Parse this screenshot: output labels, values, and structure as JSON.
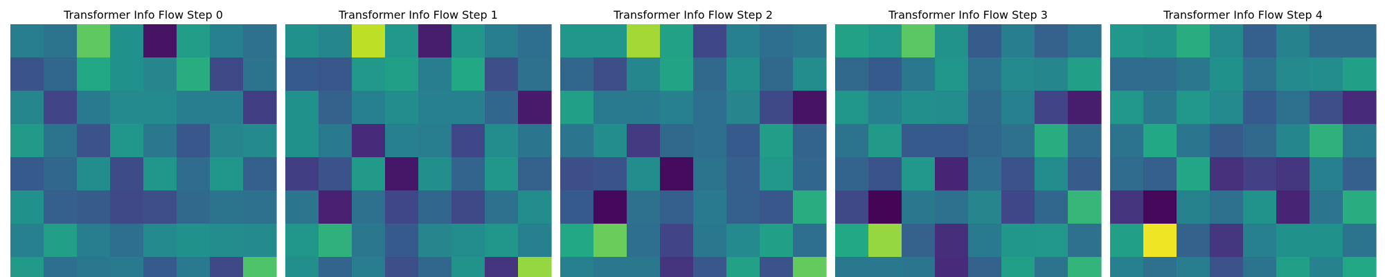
{
  "figure": {
    "background": "#ffffff"
  },
  "chart_data": [
    {
      "type": "heatmap",
      "title": "Transformer Info Flow Step 0",
      "colormap": "viridis",
      "axes": "off",
      "grid": false,
      "values": [
        [
          0.42,
          0.38,
          0.75,
          0.5,
          0.05,
          0.55,
          0.43,
          0.37
        ],
        [
          0.26,
          0.33,
          0.6,
          0.5,
          0.45,
          0.62,
          0.22,
          0.38
        ],
        [
          0.46,
          0.2,
          0.41,
          0.47,
          0.47,
          0.42,
          0.42,
          0.18
        ],
        [
          0.54,
          0.38,
          0.25,
          0.52,
          0.4,
          0.27,
          0.45,
          0.47
        ],
        [
          0.28,
          0.33,
          0.48,
          0.23,
          0.52,
          0.35,
          0.52,
          0.3
        ],
        [
          0.5,
          0.3,
          0.29,
          0.22,
          0.24,
          0.34,
          0.38,
          0.37
        ],
        [
          0.43,
          0.56,
          0.42,
          0.36,
          0.47,
          0.5,
          0.48,
          0.47
        ],
        [
          0.54,
          0.36,
          0.4,
          0.41,
          0.28,
          0.41,
          0.22,
          0.72
        ]
      ]
    },
    {
      "type": "heatmap",
      "title": "Transformer Info Flow Step 1",
      "colormap": "viridis",
      "axes": "off",
      "grid": false,
      "values": [
        [
          0.5,
          0.46,
          0.9,
          0.53,
          0.08,
          0.52,
          0.42,
          0.36
        ],
        [
          0.28,
          0.27,
          0.53,
          0.56,
          0.42,
          0.6,
          0.24,
          0.37
        ],
        [
          0.5,
          0.31,
          0.43,
          0.48,
          0.43,
          0.43,
          0.33,
          0.07
        ],
        [
          0.5,
          0.41,
          0.12,
          0.43,
          0.42,
          0.21,
          0.48,
          0.39
        ],
        [
          0.18,
          0.25,
          0.54,
          0.06,
          0.49,
          0.32,
          0.52,
          0.31
        ],
        [
          0.39,
          0.09,
          0.37,
          0.21,
          0.33,
          0.22,
          0.37,
          0.48
        ],
        [
          0.52,
          0.64,
          0.4,
          0.28,
          0.45,
          0.48,
          0.52,
          0.43
        ],
        [
          0.49,
          0.32,
          0.42,
          0.24,
          0.33,
          0.51,
          0.15,
          0.84
        ]
      ]
    },
    {
      "type": "heatmap",
      "title": "Transformer Info Flow Step 2",
      "colormap": "viridis",
      "axes": "off",
      "grid": false,
      "values": [
        [
          0.52,
          0.52,
          0.86,
          0.57,
          0.21,
          0.43,
          0.36,
          0.4
        ],
        [
          0.33,
          0.24,
          0.46,
          0.58,
          0.34,
          0.49,
          0.34,
          0.48
        ],
        [
          0.56,
          0.41,
          0.41,
          0.43,
          0.36,
          0.45,
          0.22,
          0.05
        ],
        [
          0.39,
          0.48,
          0.17,
          0.34,
          0.36,
          0.28,
          0.55,
          0.32
        ],
        [
          0.24,
          0.26,
          0.48,
          0.03,
          0.38,
          0.3,
          0.53,
          0.33
        ],
        [
          0.28,
          0.02,
          0.37,
          0.3,
          0.41,
          0.3,
          0.27,
          0.62
        ],
        [
          0.6,
          0.77,
          0.36,
          0.2,
          0.4,
          0.47,
          0.56,
          0.36
        ],
        [
          0.43,
          0.4,
          0.4,
          0.15,
          0.27,
          0.57,
          0.25,
          0.76
        ]
      ]
    },
    {
      "type": "heatmap",
      "title": "Transformer Info Flow Step 3",
      "colormap": "viridis",
      "axes": "off",
      "grid": false,
      "values": [
        [
          0.57,
          0.53,
          0.74,
          0.51,
          0.29,
          0.42,
          0.31,
          0.39
        ],
        [
          0.34,
          0.28,
          0.4,
          0.52,
          0.37,
          0.47,
          0.46,
          0.56
        ],
        [
          0.52,
          0.43,
          0.49,
          0.48,
          0.34,
          0.43,
          0.2,
          0.08
        ],
        [
          0.38,
          0.54,
          0.28,
          0.28,
          0.33,
          0.37,
          0.62,
          0.35
        ],
        [
          0.32,
          0.26,
          0.53,
          0.1,
          0.36,
          0.25,
          0.48,
          0.29
        ],
        [
          0.22,
          0.01,
          0.4,
          0.37,
          0.45,
          0.21,
          0.33,
          0.66
        ],
        [
          0.6,
          0.84,
          0.31,
          0.13,
          0.41,
          0.52,
          0.53,
          0.37
        ],
        [
          0.4,
          0.4,
          0.39,
          0.12,
          0.31,
          0.56,
          0.38,
          0.65
        ]
      ]
    },
    {
      "type": "heatmap",
      "title": "Transformer Info Flow Step 4",
      "colormap": "viridis",
      "axes": "off",
      "grid": false,
      "values": [
        [
          0.53,
          0.51,
          0.62,
          0.47,
          0.3,
          0.44,
          0.34,
          0.34
        ],
        [
          0.35,
          0.35,
          0.4,
          0.5,
          0.37,
          0.47,
          0.48,
          0.56
        ],
        [
          0.53,
          0.4,
          0.53,
          0.47,
          0.28,
          0.37,
          0.24,
          0.12
        ],
        [
          0.38,
          0.6,
          0.39,
          0.29,
          0.34,
          0.46,
          0.64,
          0.41
        ],
        [
          0.35,
          0.3,
          0.59,
          0.14,
          0.19,
          0.16,
          0.43,
          0.3
        ],
        [
          0.15,
          0.02,
          0.44,
          0.37,
          0.51,
          0.1,
          0.39,
          0.62
        ],
        [
          0.56,
          0.98,
          0.31,
          0.16,
          0.43,
          0.5,
          0.5,
          0.38
        ],
        [
          0.43,
          0.37,
          0.42,
          0.25,
          0.38,
          0.56,
          0.44,
          0.6
        ]
      ]
    }
  ]
}
